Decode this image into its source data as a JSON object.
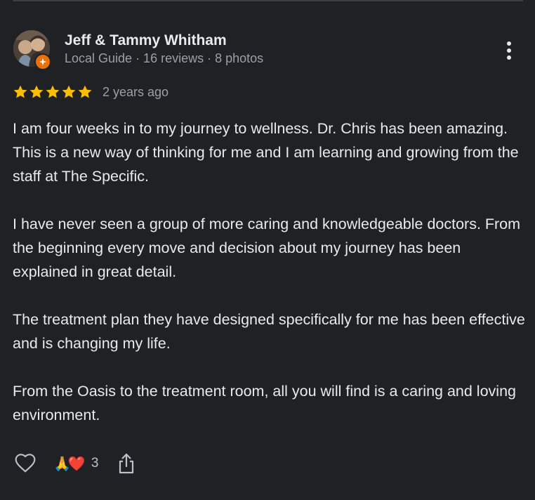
{
  "reviewer": {
    "name": "Jeff & Tammy Whitham",
    "meta": "Local Guide · 16 reviews · 8 photos"
  },
  "rating": {
    "stars": 5,
    "max": 5,
    "date": "2 years ago"
  },
  "review": {
    "paragraphs": [
      "I am four weeks in to my journey to wellness. Dr. Chris has been amazing. This is a new way of thinking for me and I am learning and growing from the staff at The Specific.",
      "I have never seen a group of more caring and knowledgeable doctors. From the beginning every move and decision about my journey has been explained in great detail.",
      "The treatment plan they have designed specifically for me has been effective and is changing my life.",
      "From the Oasis to the treatment room, all you will find is a caring and loving environment."
    ]
  },
  "actions": {
    "reactions": {
      "emoji_1": "🙏",
      "emoji_2": "❤️",
      "count": "3"
    }
  },
  "icons": {
    "more": "more-vert-icon",
    "like": "heart-outline-icon",
    "share": "share-icon",
    "badge": "local-guide-badge-icon",
    "star": "star-icon"
  },
  "colors": {
    "background": "#202124",
    "text_primary": "#e8eaed",
    "text_secondary": "#9aa0a6",
    "star": "#fbbc04",
    "badge": "#e8710a",
    "heart": "#d93025"
  }
}
